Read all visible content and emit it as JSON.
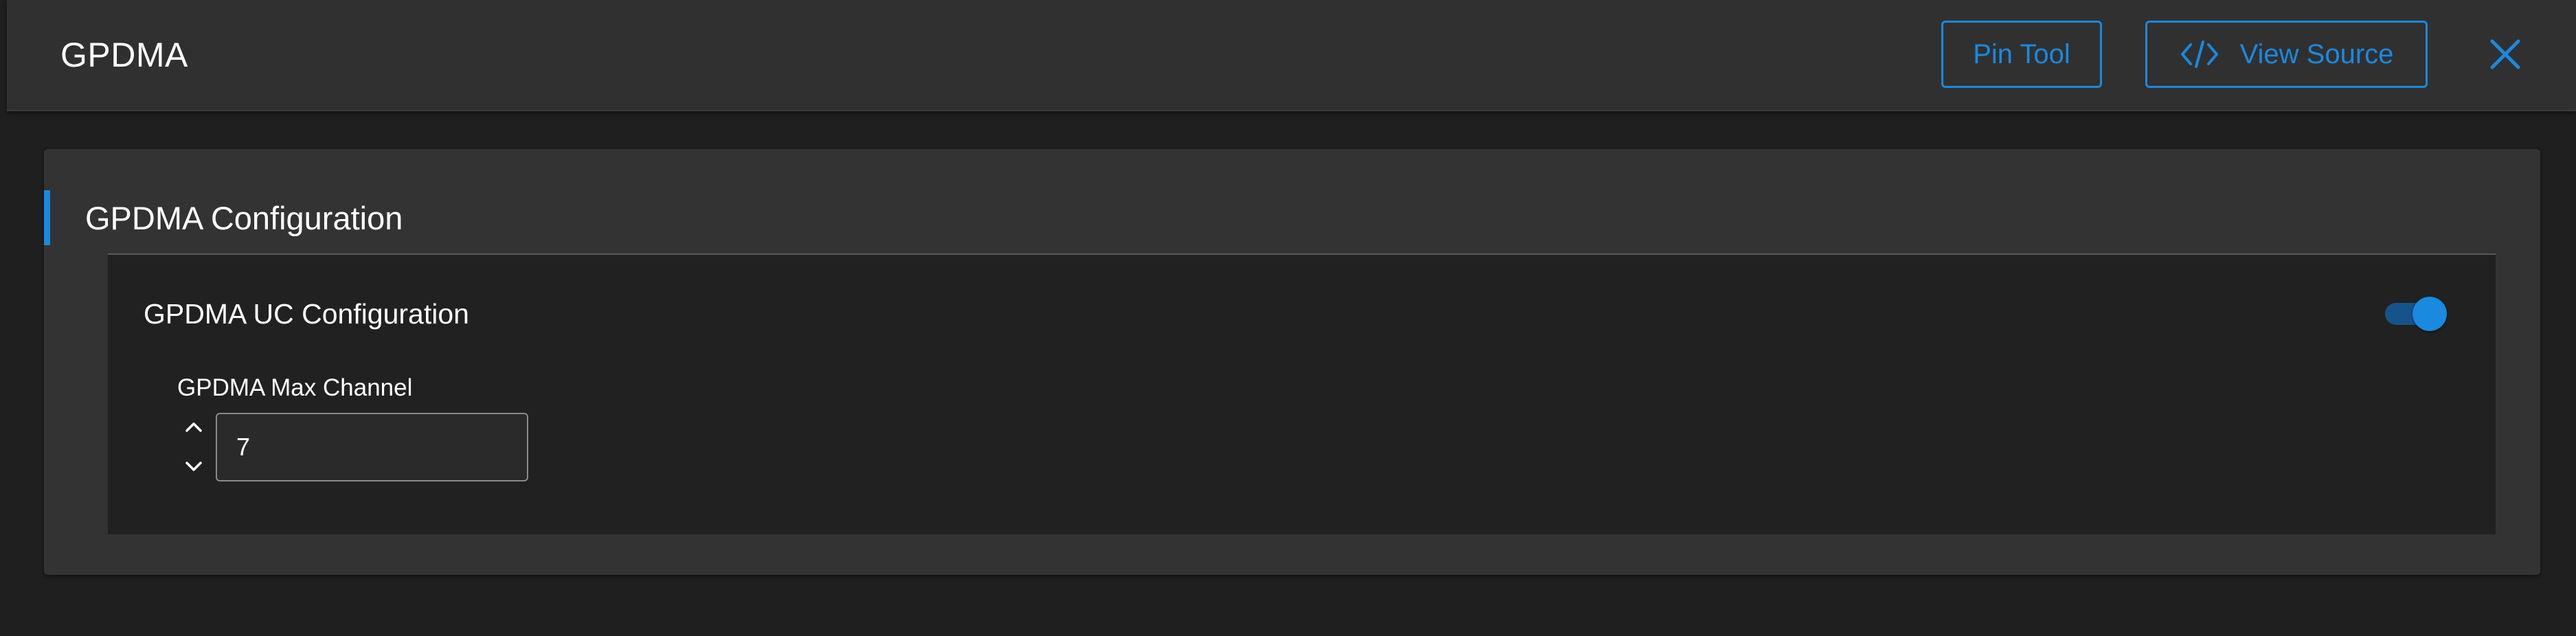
{
  "header": {
    "title": "GPDMA",
    "pin_tool_label": "Pin Tool",
    "view_source_label": "View Source",
    "close_icon": "close-icon",
    "code_icon": "code-icon"
  },
  "config": {
    "title": "GPDMA Configuration",
    "uc_section": {
      "title": "GPDMA UC Configuration",
      "toggle_enabled": true,
      "max_channel_label": "GPDMA Max Channel",
      "max_channel_value": "7"
    }
  },
  "colors": {
    "accent": "#1a89e0",
    "background": "#1f1f1f",
    "card": "#333333",
    "panel": "#212121"
  }
}
